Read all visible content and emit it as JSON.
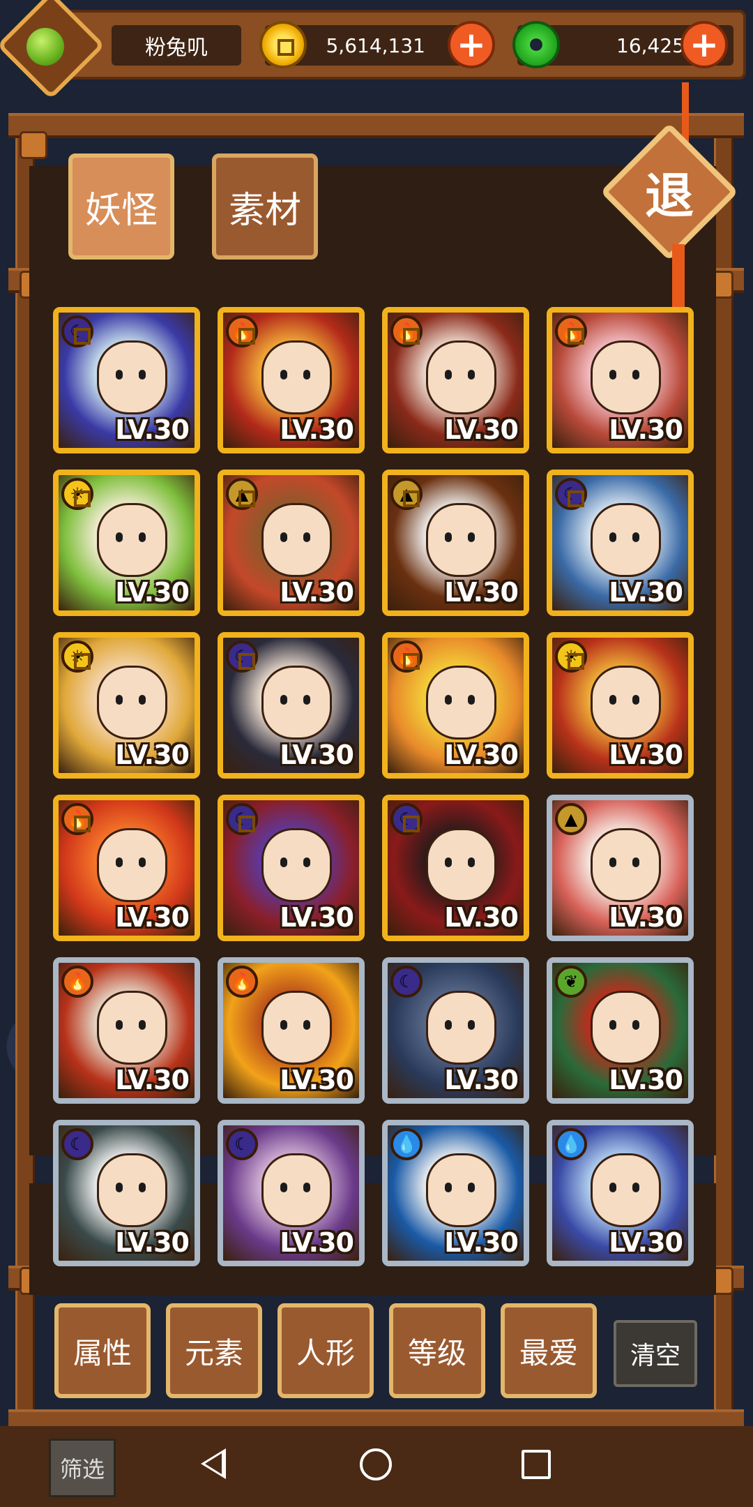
{
  "header": {
    "player_name": "粉兔叽",
    "gold": "5,614,131",
    "jade": "16,425"
  },
  "tabs": [
    {
      "label": "妖怪",
      "active": true
    },
    {
      "label": "素材",
      "active": false
    }
  ],
  "exit_label": "退",
  "monsters": [
    {
      "level": "LV.30",
      "frame": "gold",
      "element": "moon",
      "palette": [
        "#3a3aa6",
        "#d0e8f0"
      ]
    },
    {
      "level": "LV.30",
      "frame": "gold",
      "element": "fire",
      "palette": [
        "#b32a1a",
        "#f5b33a"
      ]
    },
    {
      "level": "LV.30",
      "frame": "gold",
      "element": "fire",
      "palette": [
        "#8a2a1a",
        "#f2e4d8"
      ]
    },
    {
      "level": "LV.30",
      "frame": "gold",
      "element": "fire",
      "palette": [
        "#b84a3a",
        "#f7c4cc"
      ]
    },
    {
      "level": "LV.30",
      "frame": "gold",
      "element": "sun",
      "palette": [
        "#7fbf3e",
        "#f7eed8"
      ]
    },
    {
      "level": "LV.30",
      "frame": "gold",
      "element": "earth",
      "palette": [
        "#c4482a",
        "#8a5a2a"
      ]
    },
    {
      "level": "LV.30",
      "frame": "gold",
      "element": "earth",
      "palette": [
        "#6a3010",
        "#f4f4f4"
      ]
    },
    {
      "level": "LV.30",
      "frame": "gold",
      "element": "moon",
      "palette": [
        "#3a6aa6",
        "#dde9f4"
      ]
    },
    {
      "level": "LV.30",
      "frame": "gold",
      "element": "sun",
      "palette": [
        "#e0a83a",
        "#f6d8b8"
      ]
    },
    {
      "level": "LV.30",
      "frame": "gold",
      "element": "moon",
      "palette": [
        "#2a2a3a",
        "#f4e4d4"
      ]
    },
    {
      "level": "LV.30",
      "frame": "gold",
      "element": "fire",
      "palette": [
        "#e88a2a",
        "#f4d43a"
      ]
    },
    {
      "level": "LV.30",
      "frame": "gold",
      "element": "sun",
      "palette": [
        "#b8321a",
        "#f2b83a"
      ]
    },
    {
      "level": "LV.30",
      "frame": "gold",
      "element": "fire",
      "palette": [
        "#d2381a",
        "#f77a2a"
      ]
    },
    {
      "level": "LV.30",
      "frame": "gold",
      "element": "moon",
      "palette": [
        "#8a1f2a",
        "#5a3aa6"
      ]
    },
    {
      "level": "LV.30",
      "frame": "gold",
      "element": "moon",
      "palette": [
        "#8a1a1a",
        "#2a1a1a"
      ]
    },
    {
      "level": "LV.30",
      "frame": "silver",
      "element": "earth",
      "palette": [
        "#d8625a",
        "#f7f0e8"
      ]
    },
    {
      "level": "LV.30",
      "frame": "silver",
      "element": "fire",
      "palette": [
        "#b8321a",
        "#e8e0d0"
      ]
    },
    {
      "level": "LV.30",
      "frame": "silver",
      "element": "fire",
      "palette": [
        "#f2a21a",
        "#b84a1a"
      ]
    },
    {
      "level": "LV.30",
      "frame": "silver",
      "element": "moon",
      "palette": [
        "#2a3a5a",
        "#5a6a8a"
      ]
    },
    {
      "level": "LV.30",
      "frame": "silver",
      "element": "leaf",
      "palette": [
        "#2a6a3a",
        "#c8281a"
      ]
    },
    {
      "level": "LV.30",
      "frame": "silver",
      "element": "moon",
      "palette": [
        "#3a4a4a",
        "#f4f4f4"
      ]
    },
    {
      "level": "LV.30",
      "frame": "silver",
      "element": "moon",
      "palette": [
        "#6a3a8a",
        "#d8b8d8"
      ]
    },
    {
      "level": "LV.30",
      "frame": "silver",
      "element": "water",
      "palette": [
        "#1a5aa6",
        "#f4f4f4"
      ]
    },
    {
      "level": "LV.30",
      "frame": "silver",
      "element": "water",
      "palette": [
        "#3a4aa6",
        "#b8d8f4"
      ]
    }
  ],
  "element_icons": {
    "moon": {
      "color": "#3a2a8a",
      "glyph": "☾"
    },
    "fire": {
      "color": "#e8661a",
      "glyph": "🔥"
    },
    "sun": {
      "color": "#f4c41a",
      "glyph": "☀"
    },
    "earth": {
      "color": "#c4982a",
      "glyph": "▲"
    },
    "leaf": {
      "color": "#5aa62a",
      "glyph": "❦"
    },
    "water": {
      "color": "#2a8ae8",
      "glyph": "💧"
    }
  },
  "filters": [
    {
      "label": "属性"
    },
    {
      "label": "元素"
    },
    {
      "label": "人形"
    },
    {
      "label": "等级"
    },
    {
      "label": "最爱"
    }
  ],
  "clear_label": "清空",
  "bottom": {
    "filter_tab": "筛选"
  }
}
